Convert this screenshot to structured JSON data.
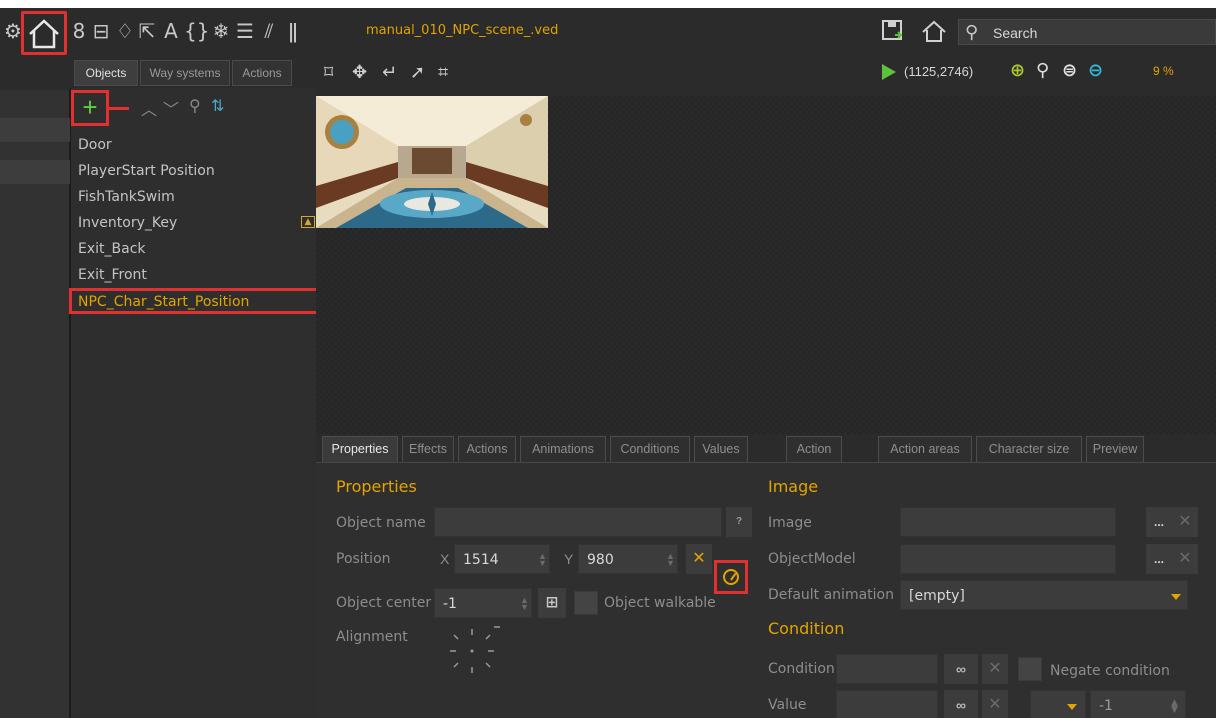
{
  "toolbar": {
    "file_title": "manual_010_NPC_scene_.ved",
    "search_label": "Search",
    "icons": [
      "gear-icon",
      "home-icon",
      "link-icon",
      "dialog-icon",
      "gem-icon",
      "cursor-icon",
      "text-icon",
      "braces-icon",
      "snowflake-icon",
      "comment-icon",
      "stripes-icon",
      "audio-icon"
    ]
  },
  "objects_panel": {
    "tabs": [
      "Objects",
      "Way systems",
      "Actions"
    ],
    "items": [
      {
        "label": "Door"
      },
      {
        "label": "PlayerStart Position"
      },
      {
        "label": "FishTankSwim"
      },
      {
        "label": "Inventory_Key"
      },
      {
        "label": "Exit_Back"
      },
      {
        "label": "Exit_Front"
      },
      {
        "label": "NPC_Char_Start_Position"
      }
    ],
    "selected": "NPC_Char_Start_Position"
  },
  "canvas_toolbar": {
    "coords": "(1125,2746)",
    "zoom": "9 %"
  },
  "prop_tabs": [
    "Properties",
    "Effects",
    "Actions",
    "Animations",
    "Conditions",
    "Values",
    "Action",
    "Action areas",
    "Character size",
    "Preview"
  ],
  "properties": {
    "title": "Properties",
    "object_name_label": "Object name",
    "object_name_value": "",
    "help_label": "?",
    "position_label": "Position",
    "x_label": "X",
    "x_value": "1514",
    "y_label": "Y",
    "y_value": "980",
    "object_center_label": "Object center",
    "object_center_value": "-1",
    "object_walkable_label": "Object walkable",
    "alignment_label": "Alignment"
  },
  "image": {
    "title": "Image",
    "image_label": "Image",
    "object_model_label": "ObjectModel",
    "default_animation_label": "Default animation",
    "default_animation_value": "[empty]",
    "more_label": "..."
  },
  "condition": {
    "title": "Condition",
    "condition_label": "Condition",
    "negate_label": "Negate condition",
    "value_label": "Value",
    "value_number": "-1"
  },
  "colors": {
    "accent": "#e4a400",
    "highlight": "#e03030",
    "add_green": "#5fd03a",
    "background": "#2b2b2b"
  }
}
